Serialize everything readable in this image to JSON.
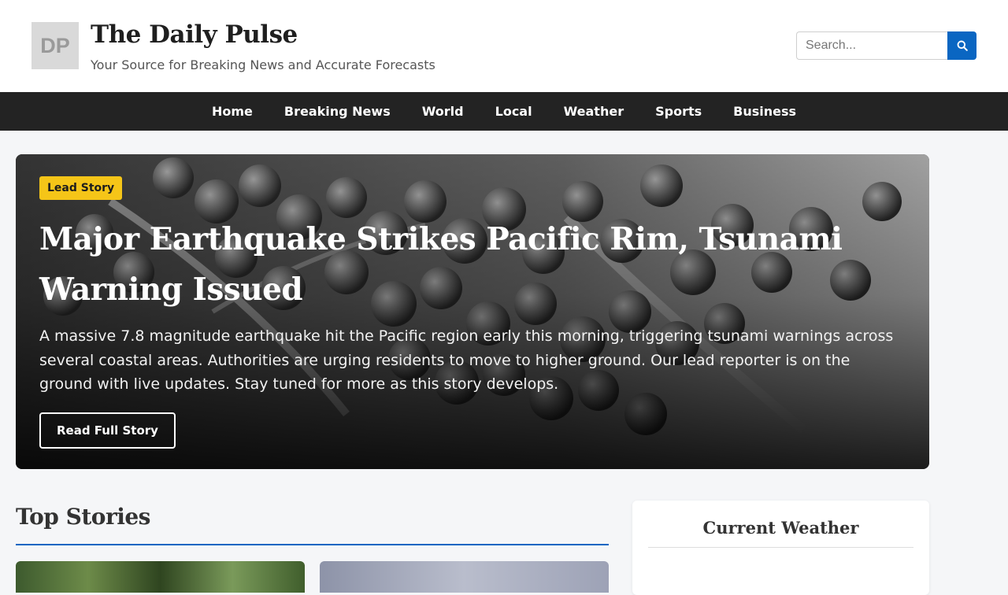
{
  "header": {
    "logo_text": "DP",
    "title": "The Daily Pulse",
    "tagline": "Your Source for Breaking News and Accurate Forecasts",
    "search": {
      "placeholder": "Search..."
    }
  },
  "nav": {
    "items": [
      {
        "label": "Home"
      },
      {
        "label": "Breaking News"
      },
      {
        "label": "World"
      },
      {
        "label": "Local"
      },
      {
        "label": "Weather"
      },
      {
        "label": "Sports"
      },
      {
        "label": "Business"
      }
    ]
  },
  "hero": {
    "badge": "Lead Story",
    "title": "Major Earthquake Strikes Pacific Rim, Tsunami Warning Issued",
    "summary": "A massive 7.8 magnitude earthquake hit the Pacific region early this morning, triggering tsunami warnings across several coastal areas. Authorities are urging residents to move to higher ground. Our lead reporter is on the ground with live updates. Stay tuned for more as this story develops.",
    "cta": "Read Full Story"
  },
  "top_stories": {
    "title": "Top Stories"
  },
  "weather": {
    "title": "Current Weather"
  },
  "colors": {
    "accent": "#0a66c2",
    "badge": "#f5c518",
    "nav_bg": "#232323"
  }
}
